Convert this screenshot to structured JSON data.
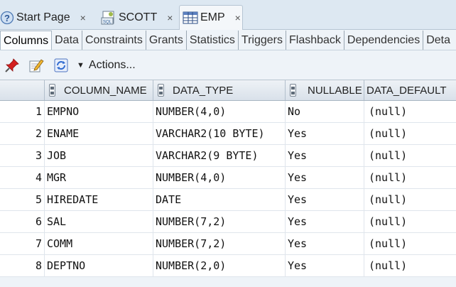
{
  "doc_tabs": [
    {
      "label": "Start Page",
      "icon": "help-icon",
      "active": false
    },
    {
      "label": "SCOTT",
      "icon": "sql-worksheet-icon",
      "active": false
    },
    {
      "label": "EMP",
      "icon": "table-icon",
      "active": true
    }
  ],
  "close_glyph": "×",
  "sub_tabs": [
    "Columns",
    "Data",
    "Constraints",
    "Grants",
    "Statistics",
    "Triggers",
    "Flashback",
    "Dependencies",
    "Deta"
  ],
  "toolbar": {
    "actions_label": "Actions...",
    "icons": [
      "pin-icon",
      "edit-icon",
      "refresh-icon"
    ]
  },
  "columns": [
    "",
    "COLUMN_NAME",
    "DATA_TYPE",
    "NULLABLE",
    "DATA_DEFAULT"
  ],
  "rows": [
    [
      "1",
      "EMPNO",
      "NUMBER(4,0)",
      "No",
      "(null)"
    ],
    [
      "2",
      "ENAME",
      "VARCHAR2(10 BYTE)",
      "Yes",
      "(null)"
    ],
    [
      "3",
      "JOB",
      "VARCHAR2(9 BYTE)",
      "Yes",
      "(null)"
    ],
    [
      "4",
      "MGR",
      "NUMBER(4,0)",
      "Yes",
      "(null)"
    ],
    [
      "5",
      "HIREDATE",
      "DATE",
      "Yes",
      "(null)"
    ],
    [
      "6",
      "SAL",
      "NUMBER(7,2)",
      "Yes",
      "(null)"
    ],
    [
      "7",
      "COMM",
      "NUMBER(7,2)",
      "Yes",
      "(null)"
    ],
    [
      "8",
      "DEPTNO",
      "NUMBER(2,0)",
      "Yes",
      "(null)"
    ]
  ],
  "colors": {
    "accent": "#3b6fb6",
    "grid_header": "#dbe3ec",
    "background": "#eef3f8"
  }
}
